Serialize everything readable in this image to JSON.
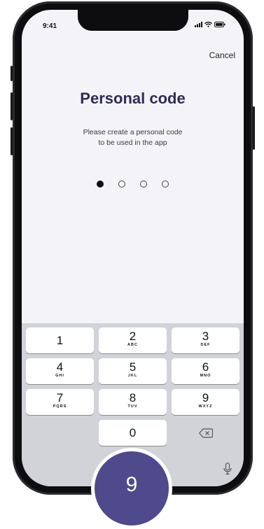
{
  "status_bar": {
    "time": "9:41"
  },
  "header": {
    "cancel_label": "Cancel"
  },
  "main": {
    "title": "Personal code",
    "subtitle_line1": "Please create a personal code",
    "subtitle_line2": "to be used in the app",
    "code_entered": 1,
    "code_length": 4
  },
  "keypad": {
    "keys": [
      {
        "digit": "1",
        "letters": ""
      },
      {
        "digit": "2",
        "letters": "ABC"
      },
      {
        "digit": "3",
        "letters": "DEF"
      },
      {
        "digit": "4",
        "letters": "GHI"
      },
      {
        "digit": "5",
        "letters": "JKL"
      },
      {
        "digit": "6",
        "letters": "MNO"
      },
      {
        "digit": "7",
        "letters": "PQRS"
      },
      {
        "digit": "8",
        "letters": "TUV"
      },
      {
        "digit": "9",
        "letters": "WXYZ"
      },
      {
        "digit": "0",
        "letters": ""
      }
    ]
  },
  "step_badge": {
    "number": "9"
  },
  "colors": {
    "title": "#2f2b57",
    "badge": "#4e4a8c",
    "keyboard_bg": "#d1d3d9"
  },
  "icons": {
    "signal": "signal-icon",
    "wifi": "wifi-icon",
    "battery": "battery-icon",
    "backspace": "backspace-icon",
    "microphone": "microphone-icon"
  }
}
